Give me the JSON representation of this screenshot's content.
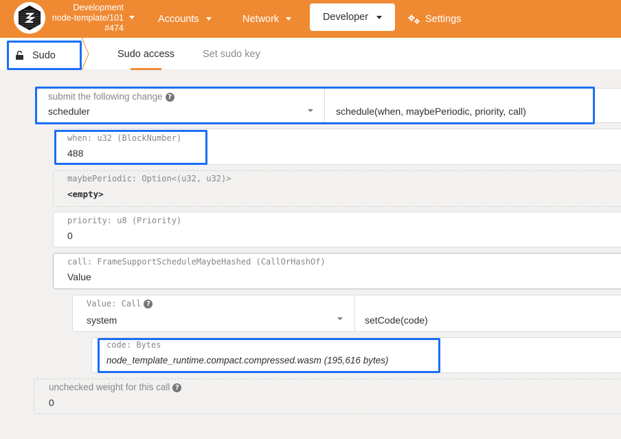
{
  "topbar": {
    "chain": {
      "network": "Development",
      "node": "node-template/101",
      "block": "#474"
    },
    "nav": [
      {
        "label": "Accounts",
        "icon": "caret-down-icon"
      },
      {
        "label": "Network",
        "icon": "caret-down-icon"
      },
      {
        "label": "Developer",
        "icon": "caret-down-icon",
        "active": true
      },
      {
        "label": "Settings",
        "icon": "gears-icon"
      }
    ]
  },
  "subnav": {
    "section": {
      "label": "Sudo",
      "icon": "unlock-icon"
    },
    "tabs": [
      {
        "label": "Sudo access",
        "active": true
      },
      {
        "label": "Set sudo key",
        "active": false
      }
    ]
  },
  "form": {
    "extrinsic": {
      "label": "submit the following change",
      "help_icon": "question-circle-icon",
      "section_value": "scheduler",
      "method_value": "schedule(when, maybePeriodic, priority, call)"
    },
    "params": {
      "when": {
        "label": "when: u32 (BlockNumber)",
        "value": "488"
      },
      "maybePeriodic": {
        "label": "maybePeriodic: Option<(u32, u32)>",
        "value": "<empty>"
      },
      "priority": {
        "label": "priority: u8 (Priority)",
        "value": "0"
      },
      "call": {
        "label": "call: FrameSupportScheduleMaybeHashed (CallOrHashOf)",
        "value": "Value"
      }
    },
    "inner_call": {
      "label": "Value: Call",
      "section_value": "system",
      "method_value": "setCode(code)",
      "code": {
        "label": "code: Bytes",
        "value": "node_template_runtime.compact.compressed.wasm (195,616 bytes)"
      }
    },
    "weight": {
      "label": "unchecked weight for this call",
      "value": "0"
    }
  },
  "colors": {
    "brand": "#ef8a33",
    "highlight": "#1a6ef5"
  }
}
